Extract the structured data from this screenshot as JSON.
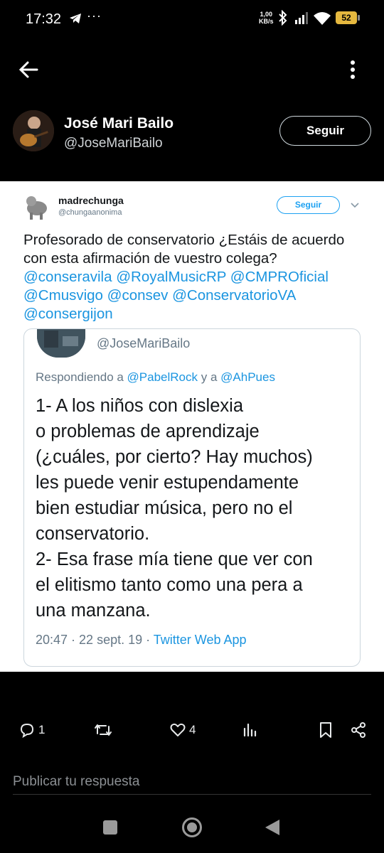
{
  "status_bar": {
    "time": "17:32",
    "speed_value": "1,00",
    "speed_unit": "KB/s",
    "battery": "52",
    "battery_color": "#e5b83f"
  },
  "profile": {
    "name": "José Mari Bailo",
    "handle": "@JoseMariBailo",
    "follow_label": "Seguir"
  },
  "embedded_tweet": {
    "author_name": "madrechunga",
    "author_handle": "@chungaanonima",
    "follow_label": "Seguir",
    "text_line1": "Profesorado de conservatorio ¿Estáis de acuerdo con esta afirmación de vuestro colega? ",
    "mentions": [
      "@conseravila",
      "@RoyalMusicRP",
      "@CMPROficial",
      "@Cmusvigo",
      "@consev",
      "@ConservatorioVA",
      "@consergijon"
    ],
    "quoted": {
      "handle": "@JoseMariBailo",
      "reply_prefix": "Respondiendo a ",
      "reply_mention_1": "@PabelRock",
      "reply_joiner": " y a ",
      "reply_mention_2": "@AhPues",
      "body_lines": [
        "1- A los niños con dislexia",
        "o problemas de aprendizaje",
        "(¿cuáles, por cierto? Hay muchos)",
        "les puede venir estupendamente",
        "bien estudiar música, pero no el",
        "conservatorio.",
        "2- Esa frase mía tiene que ver con",
        "el elitismo tanto como una pera a",
        "una manzana."
      ],
      "timestamp": "20:47 · 22 sept. 19 · ",
      "app": "Twitter Web App"
    }
  },
  "actions": {
    "reply_count": "1",
    "like_count": "4"
  },
  "reply_box": {
    "placeholder": "Publicar tu respuesta"
  },
  "colors": {
    "link": "#1b95e0",
    "background": "#000000"
  }
}
